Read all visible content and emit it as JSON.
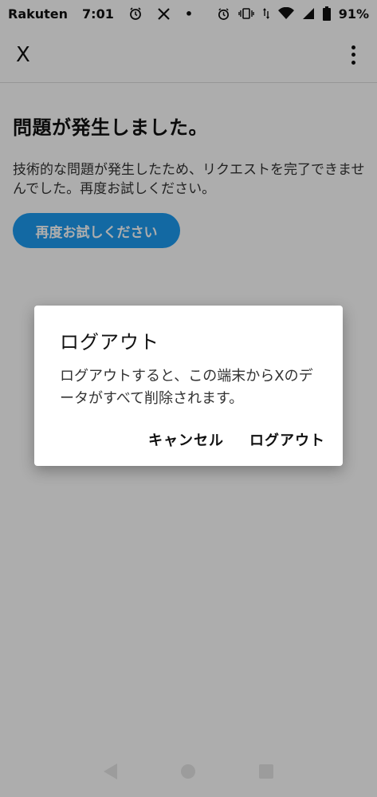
{
  "status_bar": {
    "carrier": "Rakuten",
    "time": "7:01",
    "notification_dot": "•",
    "battery": "91%",
    "icons": [
      "alarm-icon",
      "x-logo-icon",
      "alarm-icon",
      "vibrate-icon",
      "data-arrows-icon",
      "wifi-icon",
      "signal-icon",
      "battery-icon"
    ]
  },
  "app_bar": {
    "close_label": "X",
    "menu_icon": "more-vertical-icon"
  },
  "error": {
    "title": "問題が発生しました。",
    "body": "技術的な問題が発生したため、リクエストを完了できませんでした。再度お試しください。",
    "retry_label": "再度お試しください"
  },
  "dialog": {
    "title": "ログアウト",
    "body": "ログアウトすると、この端末からXのデータがすべて削除されます。",
    "cancel_label": "キャンセル",
    "confirm_label": "ログアウト"
  },
  "nav_bar": {
    "icons": [
      "back-icon",
      "home-icon",
      "recents-icon"
    ]
  },
  "colors": {
    "accent": "#1d9bf0",
    "scrim": "rgba(0,0,0,0.32)"
  }
}
